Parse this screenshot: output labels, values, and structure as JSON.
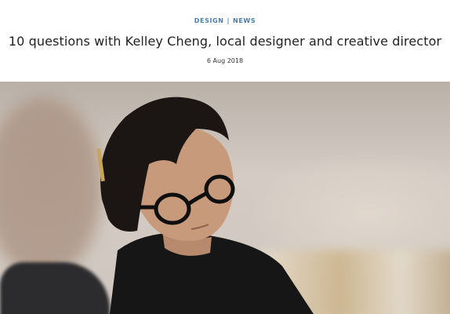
{
  "article": {
    "categories": [
      "DESIGN",
      "NEWS"
    ],
    "separator": "|",
    "title": "10 questions with Kelley Cheng, local designer and creative director",
    "date": "6 Aug 2018"
  },
  "hero": {
    "alt": "Kelley Cheng, wearing round black glasses and a black t-shirt, looking down"
  },
  "colors": {
    "accent": "#4b7ea8",
    "text": "#222222"
  }
}
